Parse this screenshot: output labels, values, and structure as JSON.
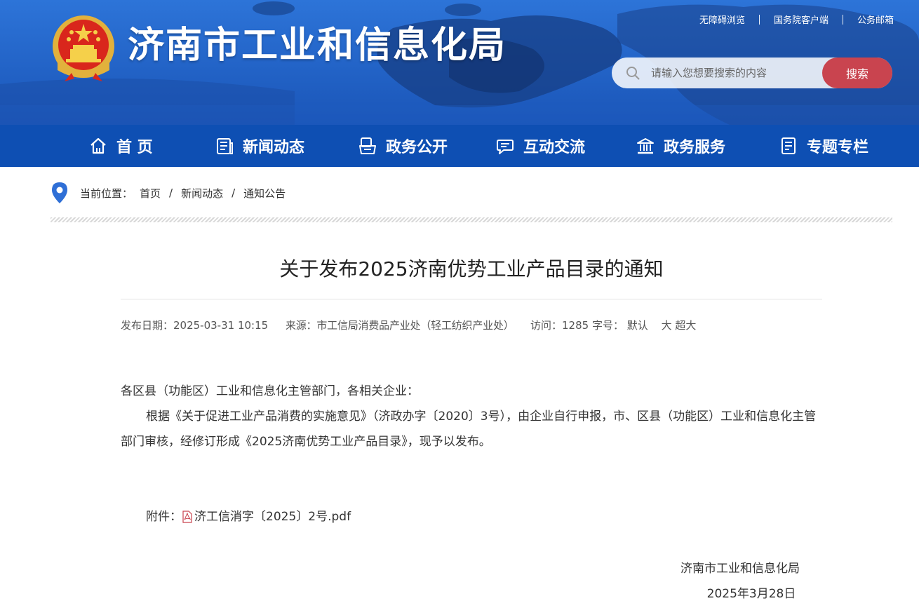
{
  "header": {
    "site_title": "济南市工业和信息化局",
    "top_links": [
      "无障碍浏览",
      "国务院客户端",
      "公务邮箱"
    ],
    "search_placeholder": "请输入您想要搜索的内容",
    "search_button": "搜索"
  },
  "nav": {
    "items": [
      {
        "label": "首 页",
        "icon": "home-icon"
      },
      {
        "label": "新闻动态",
        "icon": "newspaper-icon"
      },
      {
        "label": "政务公开",
        "icon": "folder-open-icon"
      },
      {
        "label": "互动交流",
        "icon": "chat-bubble-icon"
      },
      {
        "label": "政务服务",
        "icon": "government-building-icon"
      },
      {
        "label": "专题专栏",
        "icon": "document-list-icon"
      }
    ]
  },
  "breadcrumb": {
    "prefix": "当前位置：",
    "items": [
      "首页",
      "新闻动态",
      "通知公告"
    ],
    "separator": "/"
  },
  "article": {
    "title": "关于发布2025济南优势工业产品目录的通知",
    "meta": {
      "date": "发布日期：2025-03-31 10:15",
      "source": "来源：市工信局消费品产业处（轻工纺织产业处）",
      "visits": "访问：1285",
      "font_size_label": "字号：",
      "font_sizes": [
        "默认",
        "大",
        "超大"
      ]
    },
    "salutation": "各区县（功能区）工业和信息化主管部门，各相关企业：",
    "paragraph": "根据《关于促进工业产品消费的实施意见》（济政办字〔2020〕3号），由企业自行申报，市、区县（功能区）工业和信息化主管部门审核，经修订形成《2025济南优势工业产品目录》，现予以发布。",
    "attachment_label": "附件：",
    "attachment_file": "济工信消字〔2025〕2号.pdf",
    "signer": "济南市工业和信息化局",
    "sign_date": "2025年3月28日"
  },
  "colors": {
    "banner_blue": "#1b5ac0",
    "nav_blue": "#0e4fb3",
    "search_button": "#c9444f",
    "link_active": "#1d55b8"
  }
}
